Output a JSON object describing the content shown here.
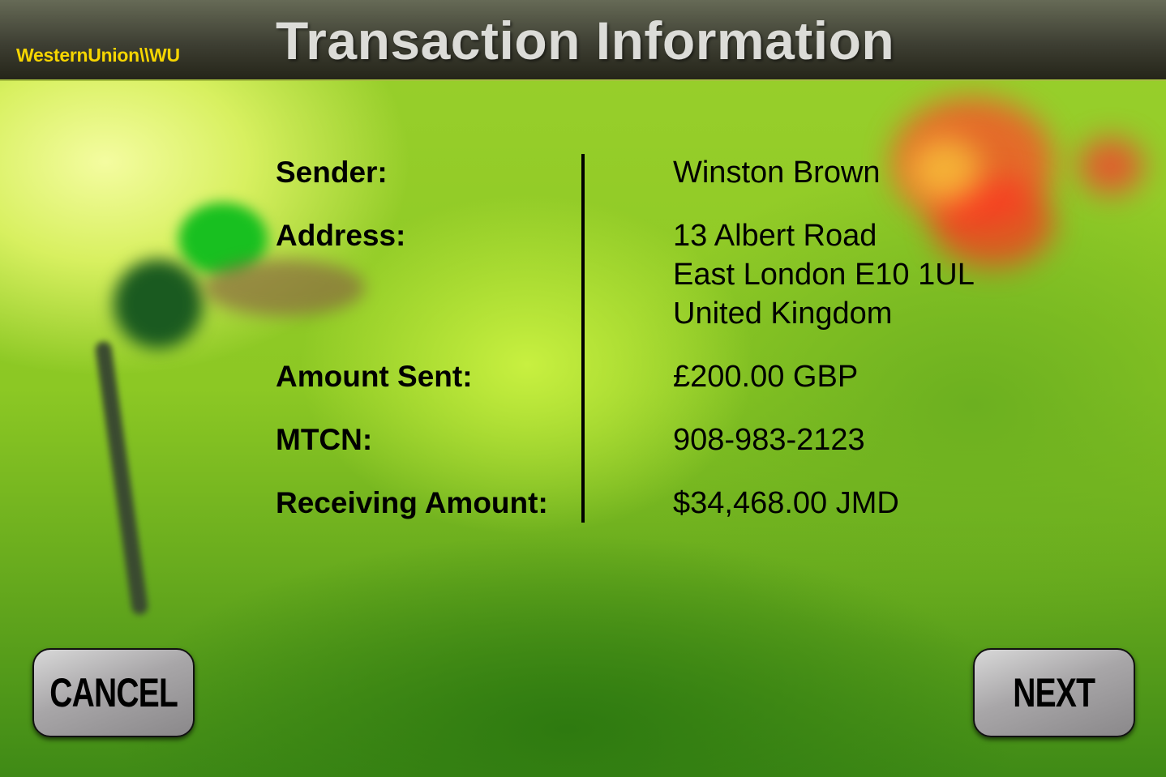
{
  "header": {
    "logo": "WesternUnion\\\\WU",
    "title": "Transaction Information"
  },
  "fields": [
    {
      "label": "Sender:",
      "value": [
        "Winston Brown"
      ]
    },
    {
      "label": "Address:",
      "value": [
        "13 Albert Road",
        "East London E10 1UL",
        "United Kingdom"
      ]
    },
    {
      "label": "Amount Sent:",
      "value": [
        "£200.00 GBP"
      ]
    },
    {
      "label": "MTCN:",
      "value": [
        "908-983-2123"
      ]
    },
    {
      "label": "Receiving Amount:",
      "value": [
        "$34,468.00 JMD"
      ]
    }
  ],
  "buttons": {
    "cancel": "CANCEL",
    "next": "NEXT"
  }
}
